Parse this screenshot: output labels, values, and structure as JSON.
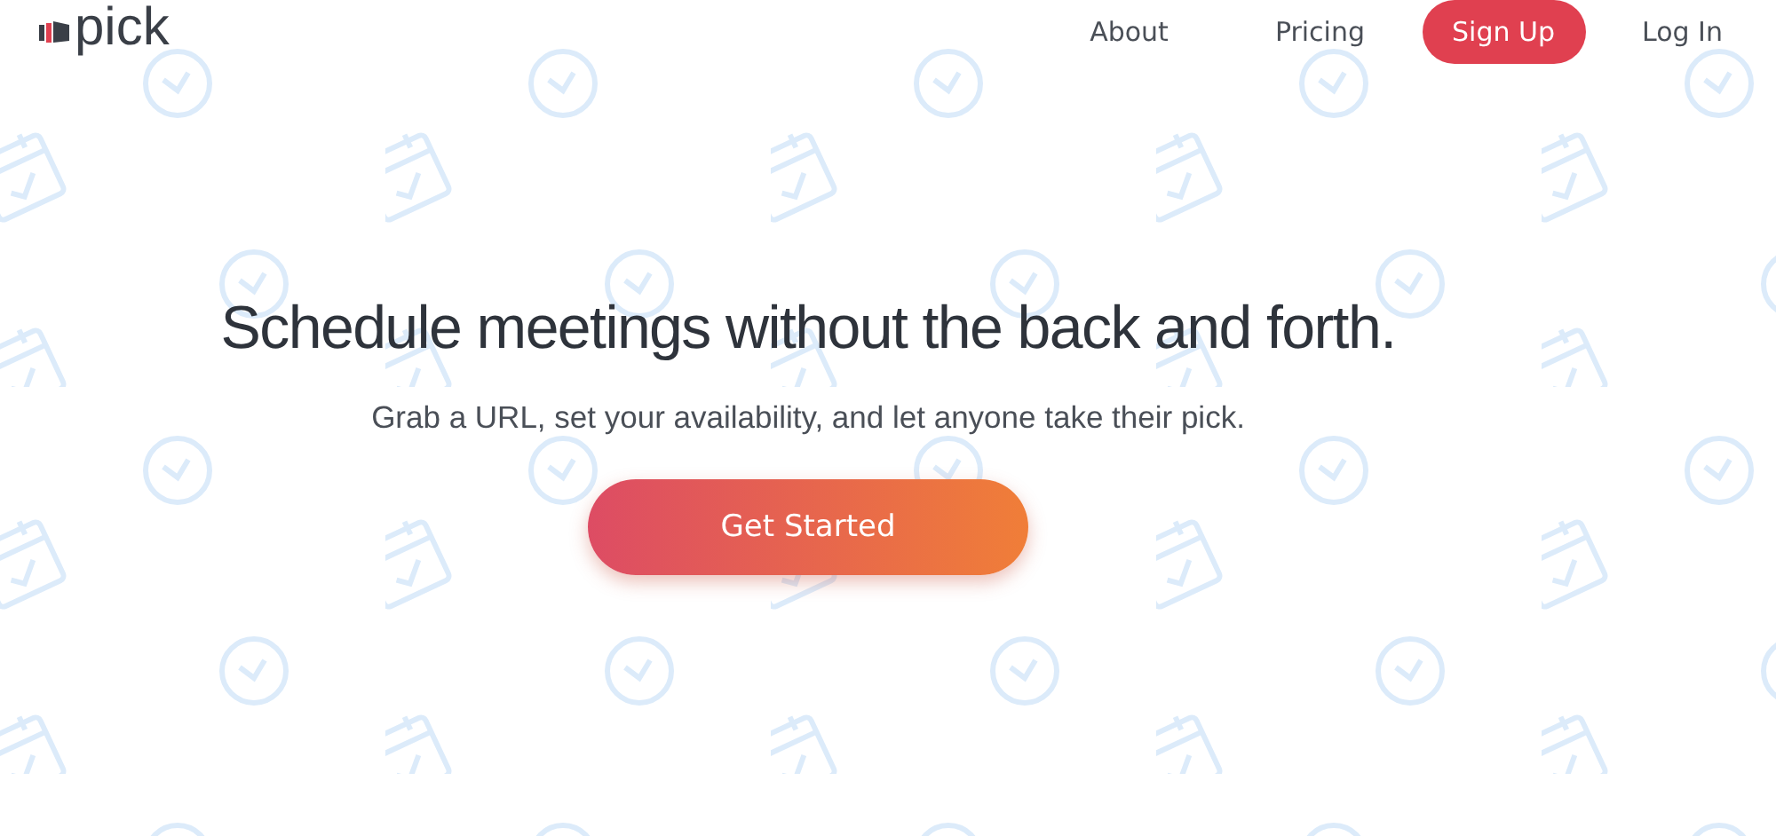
{
  "logo": {
    "text": "pick"
  },
  "nav": [
    {
      "label": "About",
      "kind": "link"
    },
    {
      "label": "Pricing",
      "kind": "link"
    },
    {
      "label": "Sign Up",
      "kind": "button"
    },
    {
      "label": "Log In",
      "kind": "link"
    }
  ],
  "hero": {
    "title": "Schedule meetings without the back and forth.",
    "subtitle": "Grab a URL, set your availability, and let anyone take their pick.",
    "cta": "Get Started"
  }
}
